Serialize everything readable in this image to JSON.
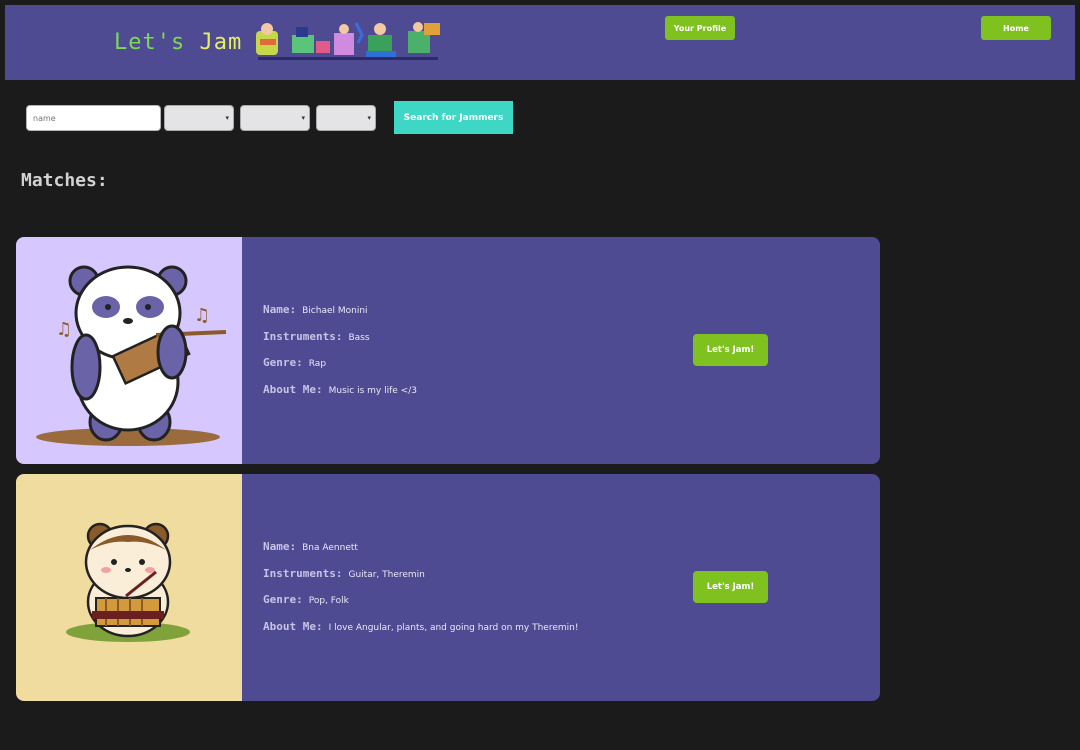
{
  "header": {
    "brand_word1": "Let's",
    "brand_word2": "Jam",
    "profile_label": "Your Profile",
    "home_label": "Home"
  },
  "search": {
    "name_placeholder": "name",
    "button_label": "Search for Jammers"
  },
  "matches_title": "Matches:",
  "labels": {
    "name": "Name:",
    "instruments": "Instruments:",
    "genre": "Genre:",
    "about": "About Me:"
  },
  "matches": [
    {
      "name": "Bichael Monini",
      "instruments": "Bass",
      "genre": "Rap",
      "about": "Music is my life </3",
      "button_label": "Let's Jam!",
      "avatar": "panda-with-panflute"
    },
    {
      "name": "Bna Aennett",
      "instruments": "Guitar, Theremin",
      "genre": "Pop, Folk",
      "about": "I love Angular, plants, and going hard on my Theremin!",
      "button_label": "Let's Jam!",
      "avatar": "bear-with-panflute"
    }
  ],
  "colors": {
    "background": "#1b1b1b",
    "panel": "#4f4b93",
    "accent_green": "#7fc21f",
    "accent_teal": "#3ed6c4"
  }
}
